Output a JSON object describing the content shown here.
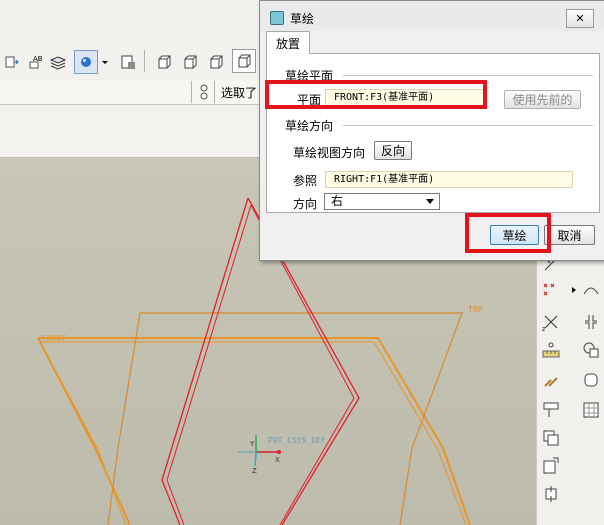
{
  "toolbar": {
    "select_label": "选取了",
    "icons": [
      "note-icon",
      "ab-text-icon",
      "layers-icon",
      "radio-icon",
      "dropdown-icon",
      "view-manager-icon",
      "box-icon",
      "box-icon",
      "box-icon",
      "box-icon",
      "box-icon"
    ]
  },
  "dialog": {
    "title": "草绘",
    "close_label": "✕",
    "tab_label": "放置",
    "sketch_plane": {
      "section_title": "草绘平面",
      "plane_label": "平面",
      "plane_value": "FRONT:F3(基准平面)",
      "use_previous_label": "使用先前的"
    },
    "sketch_orientation": {
      "section_title": "草绘方向",
      "view_direction_label": "草绘视图方向",
      "flip_label": "反向",
      "reference_label": "参照",
      "reference_value": "RIGHT:F1(基准平面)",
      "orientation_label": "方向",
      "orientation_value": "右"
    },
    "sketch_button": "草绘",
    "cancel_button": "取消"
  },
  "canvas": {
    "front_label": "FRONT",
    "top_label": "TOP",
    "csys_label": "PRT_CSYS_DEF",
    "axis_x": "X",
    "axis_y": "Y",
    "axis_z": "Z"
  },
  "colors": {
    "highlight": "#e4141c",
    "front_plane": "#e8962a",
    "right_plane": "#e0202a",
    "top_plane": "#d88a30",
    "canvas_bg": "#c5c3b3"
  }
}
